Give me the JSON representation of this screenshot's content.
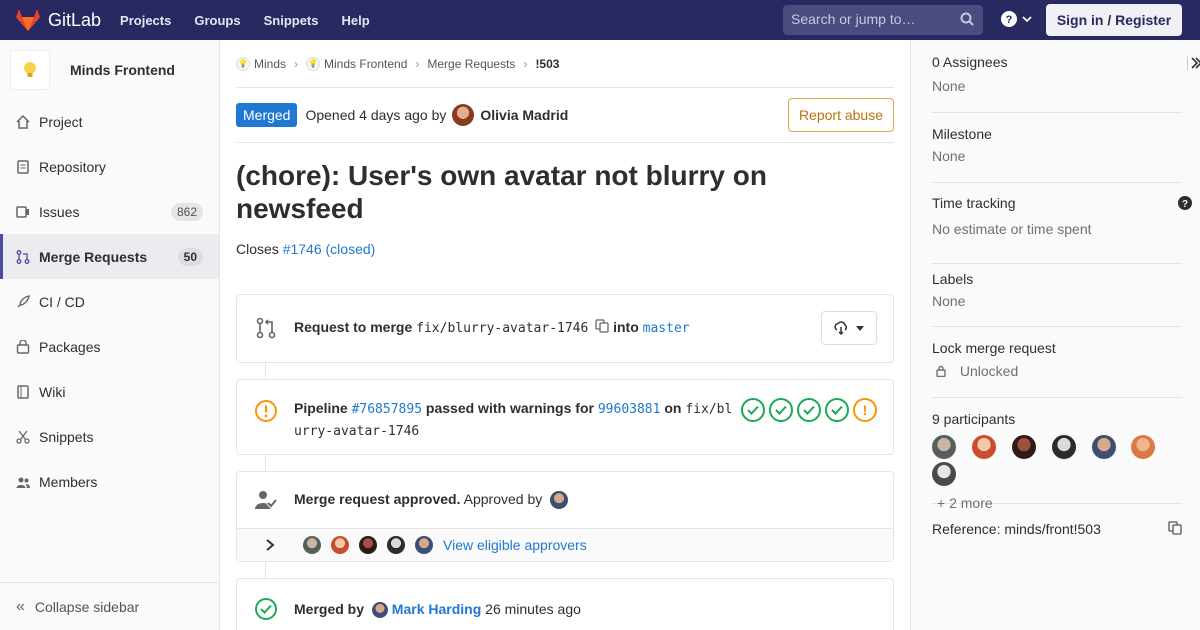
{
  "topbar": {
    "brand": "GitLab",
    "nav": [
      "Projects",
      "Groups",
      "Snippets",
      "Help"
    ],
    "search_placeholder": "Search or jump to…",
    "signin": "Sign in / Register"
  },
  "sidebar": {
    "project_name": "Minds Frontend",
    "items": [
      {
        "label": "Project",
        "icon": "home-icon",
        "count": ""
      },
      {
        "label": "Repository",
        "icon": "doc-icon",
        "count": ""
      },
      {
        "label": "Issues",
        "icon": "issues-icon",
        "count": "862"
      },
      {
        "label": "Merge Requests",
        "icon": "merge-request-icon",
        "count": "50"
      },
      {
        "label": "CI / CD",
        "icon": "rocket-icon",
        "count": ""
      },
      {
        "label": "Packages",
        "icon": "package-icon",
        "count": ""
      },
      {
        "label": "Wiki",
        "icon": "book-icon",
        "count": ""
      },
      {
        "label": "Snippets",
        "icon": "scissors-icon",
        "count": ""
      },
      {
        "label": "Members",
        "icon": "users-icon",
        "count": ""
      }
    ],
    "collapse": "Collapse sidebar"
  },
  "breadcrumb": {
    "items": [
      "Minds",
      "Minds Frontend",
      "Merge Requests"
    ],
    "current": "!503"
  },
  "mr": {
    "status": "Merged",
    "opened": "Opened 4 days ago by",
    "author": "Olivia Madrid",
    "report": "Report abuse",
    "title": "(chore): User's own avatar not blurry on newsfeed",
    "closes_prefix": "Closes",
    "closes_link": "#1746 (closed)"
  },
  "merge_widget": {
    "request_label": "Request to merge",
    "source_branch": "fix/blurry-avatar-1746",
    "into": "into",
    "target_branch": "master"
  },
  "pipeline": {
    "label": "Pipeline",
    "id": "#76857895",
    "status_text": "passed with warnings for",
    "commit": "99603881",
    "on": "on",
    "branch_part1": "fix/bl",
    "branch_part2": "urry-avatar-1746",
    "stages": [
      "passed",
      "passed",
      "passed",
      "passed",
      "warning"
    ]
  },
  "approval": {
    "label": "Merge request approved.",
    "approved_by": "Approved by",
    "eligible_link": "View eligible approvers"
  },
  "merged": {
    "label": "Merged by",
    "user": "Mark Harding",
    "time": "26 minutes ago"
  },
  "right_sidebar": {
    "assignees_label": "0 Assignees",
    "assignees_value": "None",
    "milestone_label": "Milestone",
    "milestone_value": "None",
    "time_label": "Time tracking",
    "time_value": "No estimate or time spent",
    "labels_label": "Labels",
    "labels_value": "None",
    "lock_label": "Lock merge request",
    "lock_value": "Unlocked",
    "participants_label": "9 participants",
    "more": "+ 2 more",
    "reference": "Reference: minds/front!503"
  },
  "colors": {
    "topbar": "#292961",
    "merged_badge": "#1f78d1",
    "success": "#1aaa55",
    "warning": "#fc9403",
    "link": "#1f78d1"
  }
}
